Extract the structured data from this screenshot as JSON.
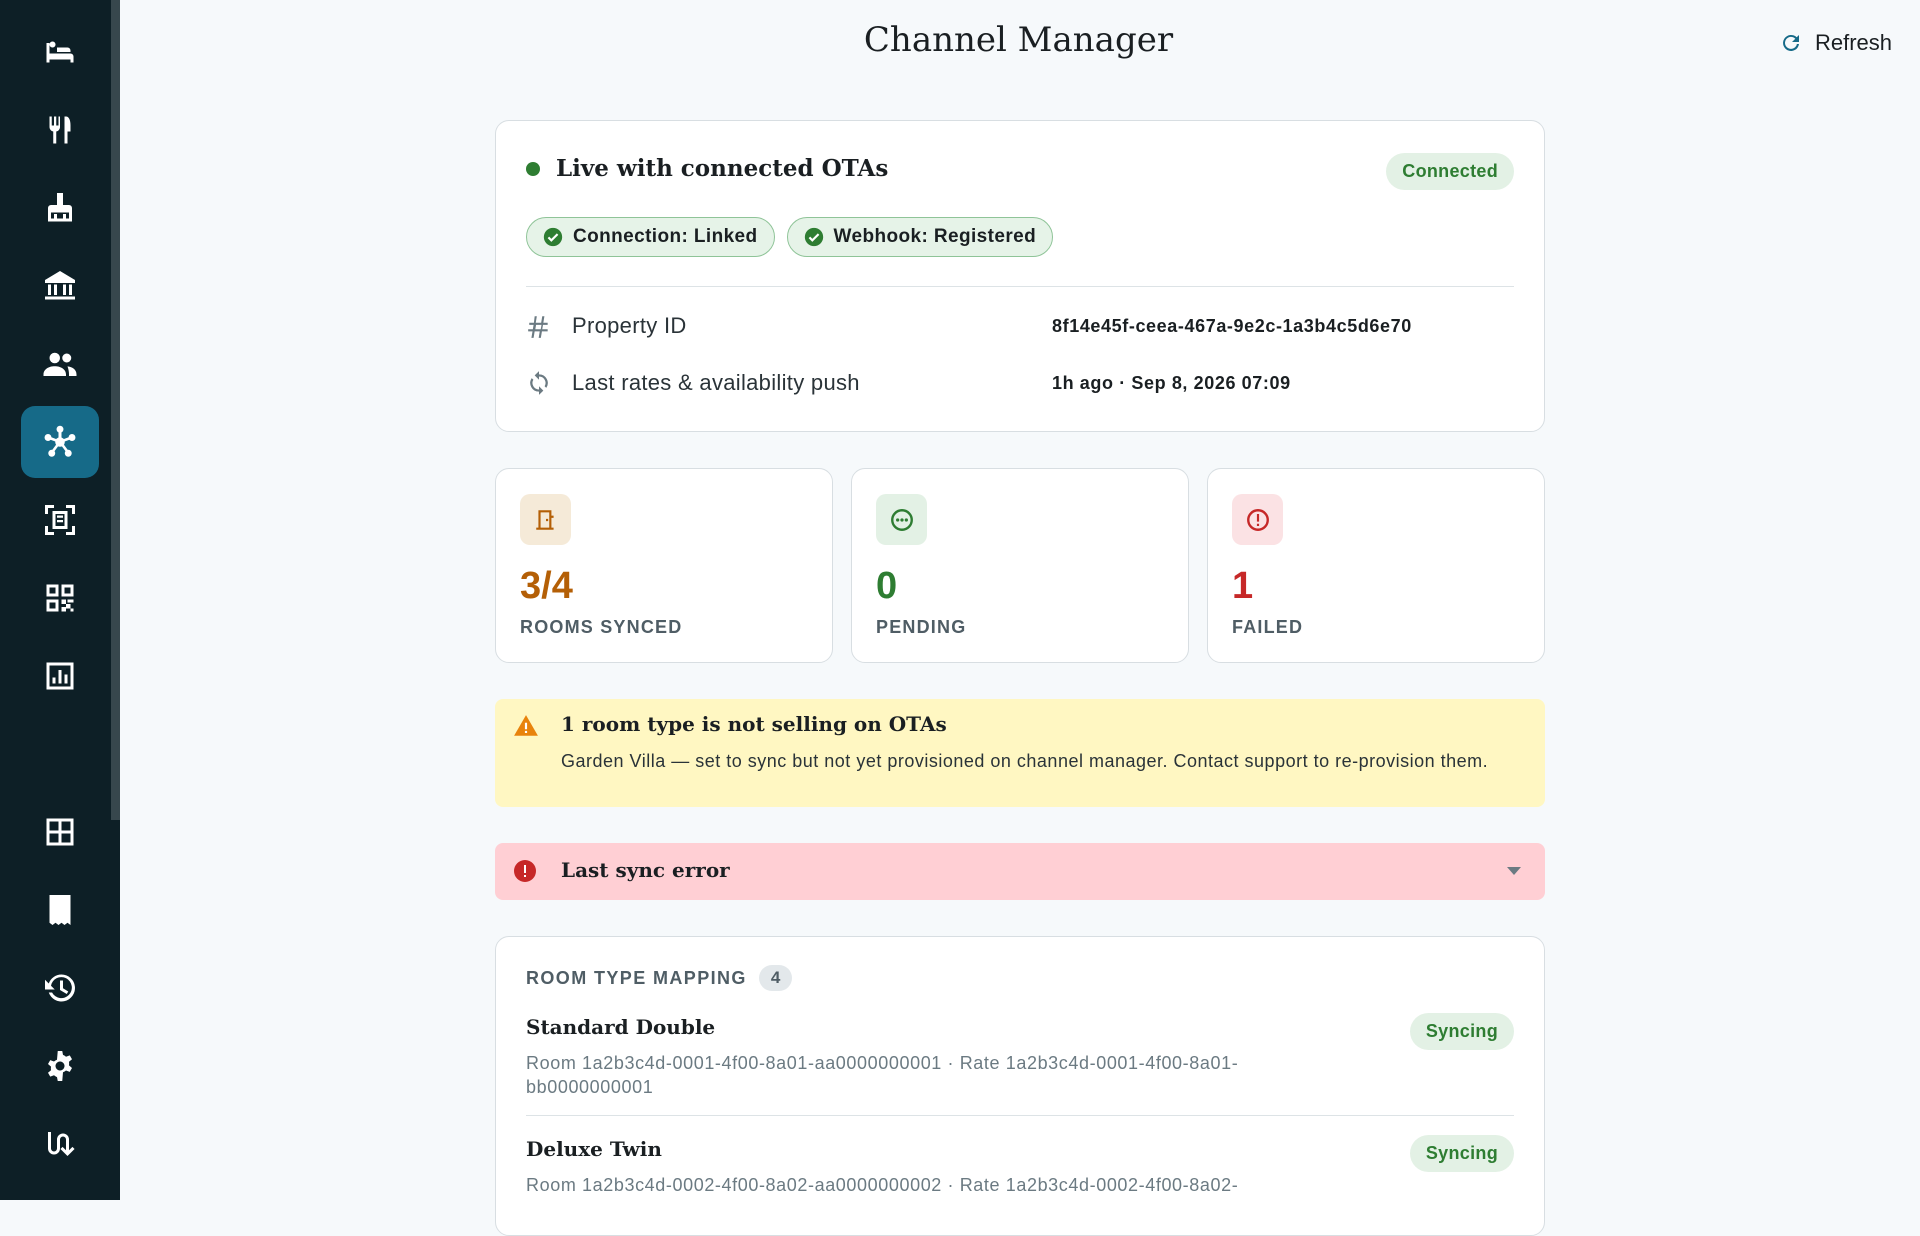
{
  "header": {
    "title": "Channel Manager",
    "refresh_label": "Refresh"
  },
  "sidebar": {
    "items": [
      {
        "icon": "bed-icon"
      },
      {
        "icon": "restaurant-icon"
      },
      {
        "icon": "housekeeping-icon"
      },
      {
        "icon": "bank-icon"
      },
      {
        "icon": "guests-icon"
      },
      {
        "icon": "channel-hub-icon",
        "active": true
      },
      {
        "icon": "scan-document-icon"
      },
      {
        "icon": "qr-code-icon"
      },
      {
        "icon": "report-chart-icon"
      },
      {
        "icon": "night-audit-icon"
      },
      {
        "icon": "floor-plan-icon"
      },
      {
        "icon": "invoice-icon"
      },
      {
        "icon": "history-icon"
      },
      {
        "icon": "settings-icon"
      },
      {
        "icon": "shift-icon"
      }
    ]
  },
  "status": {
    "title": "Live with connected OTAs",
    "badge": "Connected",
    "chips": [
      "Connection: Linked",
      "Webhook: Registered"
    ],
    "property_id_label": "Property ID",
    "property_id_value": "8f14e45f-ceea-467a-9e2c-1a3b4c5d6e70",
    "last_push_label": "Last rates & availability push",
    "last_push_value": "1h ago · Sep 8, 2026 07:09"
  },
  "stats": [
    {
      "value": "3/4",
      "label": "ROOMS SYNCED",
      "color": "#b45f06",
      "icon": "door-icon"
    },
    {
      "value": "0",
      "label": "PENDING",
      "color": "#2e7d32",
      "icon": "pending-icon"
    },
    {
      "value": "1",
      "label": "FAILED",
      "color": "#c62828",
      "icon": "alert-icon"
    }
  ],
  "warning": {
    "title": "1 room type is not selling on OTAs",
    "text": "Garden Villa — set to sync but not yet provisioned on channel manager. Contact support to re-provision them."
  },
  "error": {
    "title": "Last sync error"
  },
  "mapping": {
    "title": "ROOM TYPE MAPPING",
    "count": "4",
    "rows": [
      {
        "name": "Standard Double",
        "ids": "Room 1a2b3c4d-0001-4f00-8a01-aa0000000001  ·  Rate 1a2b3c4d-0001-4f00-8a01-bb0000000001",
        "status": "Syncing"
      },
      {
        "name": "Deluxe Twin",
        "ids": "Room 1a2b3c4d-0002-4f00-8a02-aa0000000002  ·  Rate 1a2b3c4d-0002-4f00-8a02-",
        "status": "Syncing"
      }
    ]
  }
}
